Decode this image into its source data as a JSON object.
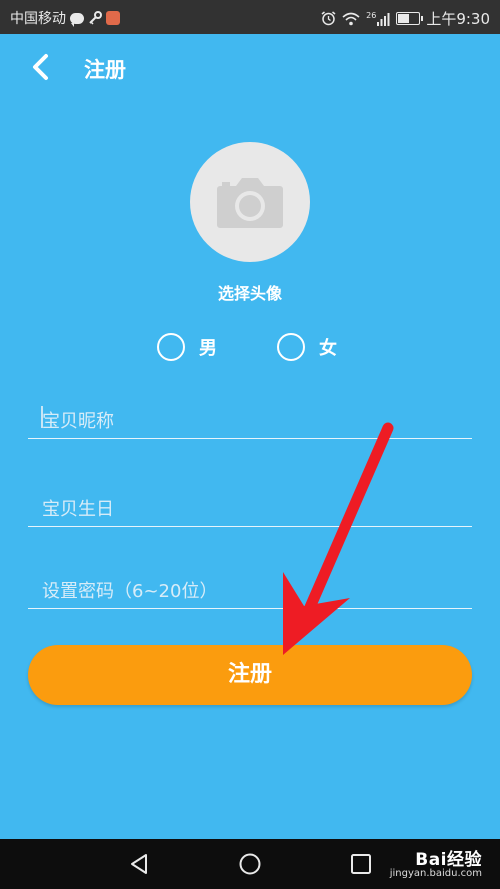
{
  "status_bar": {
    "carrier": "中国移动",
    "network": "26",
    "time": "上午9:30",
    "icons": [
      "message-icon",
      "key-icon",
      "app-icon",
      "alarm-icon",
      "wifi-icon",
      "signal-icon",
      "battery-icon"
    ],
    "battery_level": 0.6
  },
  "header": {
    "title": "注册",
    "back_icon": "chevron-left-icon"
  },
  "avatar": {
    "icon": "camera-icon",
    "label": "选择头像"
  },
  "gender": {
    "options": [
      {
        "label": "男",
        "selected": false
      },
      {
        "label": "女",
        "selected": false
      }
    ]
  },
  "form": {
    "nickname_placeholder": "宝贝昵称",
    "birthday_placeholder": "宝贝生日",
    "password_placeholder": "设置密码（6~20位）"
  },
  "submit": {
    "label": "注册"
  },
  "annotation": {
    "arrow_color": "#ee1c24"
  },
  "nav_bar": {
    "icons": [
      "back-triangle-icon",
      "home-circle-icon",
      "recents-square-icon"
    ]
  },
  "watermark": {
    "brand": "Bai经验",
    "url": "jingyan.baidu.com"
  },
  "colors": {
    "background": "#41b8f0",
    "accent": "#fb9c0e",
    "status_bar": "#323232",
    "nav_bar": "#0d0d0d"
  }
}
